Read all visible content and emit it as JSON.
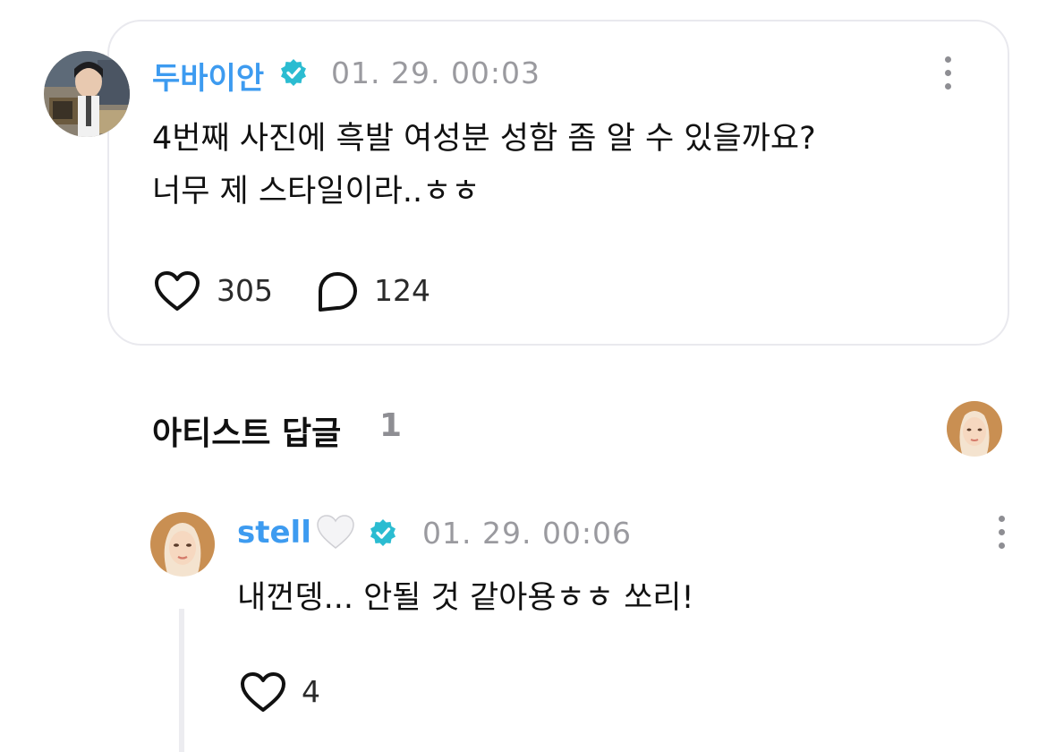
{
  "comment": {
    "username": "두바이안",
    "timestamp": "01. 29. 00:03",
    "text_line1": "4번째 사진에 흑발 여성분 성함 좀 알 수 있을까요?",
    "text_line2": "너무 제 스타일이라..ㅎㅎ",
    "likes": "305",
    "replies": "124"
  },
  "artist_section": {
    "title": "아티스트 답글",
    "count": "1"
  },
  "reply": {
    "username": "stell",
    "username_emoji": "white-heart-icon",
    "timestamp": "01. 29. 00:06",
    "text": "내껀뎅... 안될 것 같아용ㅎㅎ 쏘리!",
    "likes": "4"
  },
  "colors": {
    "username_blue": "#3d9bf0",
    "verified_teal": "#2bbcd1",
    "muted_gray": "#9a9a9f",
    "card_border": "#e9e9ee"
  },
  "icons": [
    "verified-badge-icon",
    "more-vertical-icon",
    "heart-icon",
    "comment-bubble-icon",
    "white-heart-icon"
  ]
}
